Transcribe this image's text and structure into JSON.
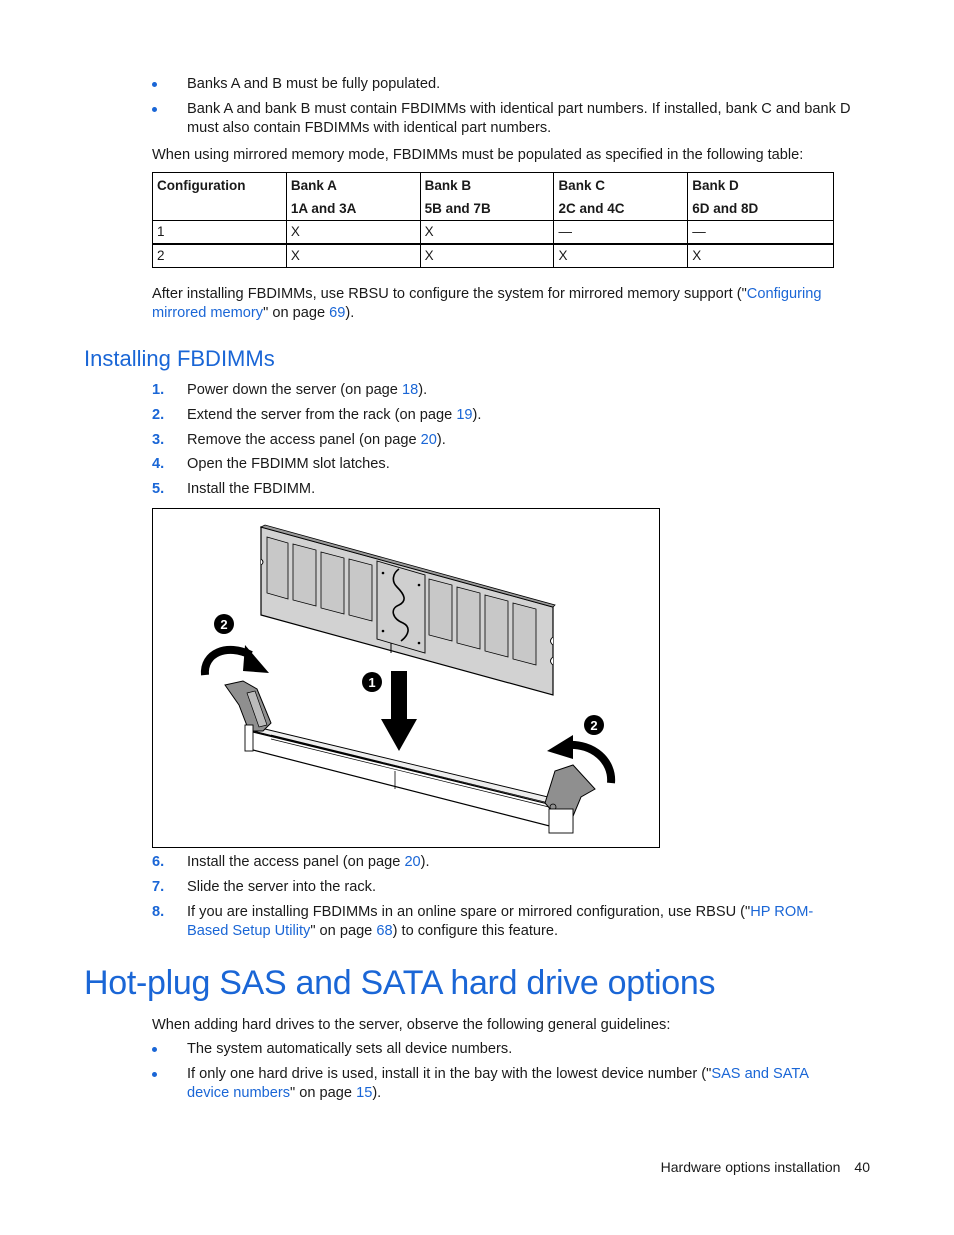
{
  "intro_bullets": [
    {
      "text": "Banks A and B must be fully populated."
    },
    {
      "text": "Bank A and bank B must contain FBDIMMs with identical part numbers. If installed, bank C and bank D must also contain FBDIMMs with identical part numbers."
    }
  ],
  "table_intro": "When using mirrored memory mode, FBDIMMs must be populated as specified in the following table:",
  "mirrored_table": {
    "headers": [
      {
        "line1": "Configuration",
        "line2": ""
      },
      {
        "line1": "Bank A",
        "line2": "1A and 3A"
      },
      {
        "line1": "Bank B",
        "line2": "5B and 7B"
      },
      {
        "line1": "Bank C",
        "line2": "2C and 4C"
      },
      {
        "line1": "Bank D",
        "line2": "6D and 8D"
      }
    ],
    "rows": [
      [
        "1",
        "X",
        "X",
        "—",
        "—"
      ],
      [
        "2",
        "X",
        "X",
        "X",
        "X"
      ]
    ]
  },
  "after_table": {
    "before": "After installing FBDIMMs, use RBSU to configure the system for mirrored memory support (\"",
    "link": "Configuring mirrored memory",
    "middle": "\" on page ",
    "page_link": "69",
    "after": ")."
  },
  "installing_section": {
    "title": "Installing FBDIMMs",
    "steps_before_figure": [
      {
        "num": "1.",
        "text": "Power down the server (on page ",
        "page": "18",
        "tail": ")."
      },
      {
        "num": "2.",
        "text": "Extend the server from the rack (on page ",
        "page": "19",
        "tail": ")."
      },
      {
        "num": "3.",
        "text": "Remove the access panel (on page ",
        "page": "20",
        "tail": ")."
      },
      {
        "num": "4.",
        "text": "Open the FBDIMM slot latches.",
        "page": null,
        "tail": ""
      },
      {
        "num": "5.",
        "text": "Install the FBDIMM.",
        "page": null,
        "tail": ""
      }
    ],
    "figure": {
      "callouts": [
        "1",
        "2",
        "2"
      ]
    },
    "steps_after_figure": [
      {
        "num": "6.",
        "text": "Install the access panel (on page ",
        "page": "20",
        "tail": ")."
      },
      {
        "num": "7.",
        "text": "Slide the server into the rack.",
        "page": null,
        "tail": ""
      },
      {
        "num": "8.",
        "text": "If you are installing FBDIMMs in an online spare or mirrored configuration, use RBSU (\"",
        "link": "HP ROM-Based Setup Utility",
        "middle": "\" on page ",
        "page": "68",
        "tail": ") to configure this feature."
      }
    ]
  },
  "hotplug_section": {
    "title": "Hot-plug SAS and SATA hard drive options",
    "intro": "When adding hard drives to the server, observe the following general guidelines:",
    "bullets": [
      {
        "text": "The system automatically sets all device numbers."
      },
      {
        "text": "If only one hard drive is used, install it in the bay with the lowest device number (\"",
        "link": "SAS and SATA device numbers",
        "middle": "\" on page ",
        "page": "15",
        "tail": ")."
      }
    ]
  },
  "footer": {
    "section": "Hardware options installation",
    "page": "40"
  },
  "colors": {
    "accent": "#1a66d6",
    "text": "#1a1a1a"
  }
}
